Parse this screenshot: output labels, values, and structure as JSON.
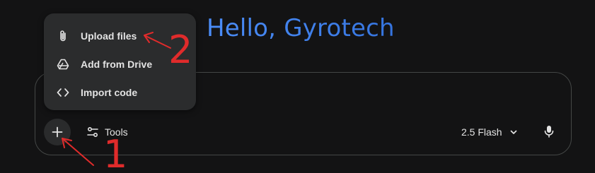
{
  "greeting": "Hello, Gyrotech",
  "composer": {
    "tools_label": "Tools",
    "model_label": "2.5 Flash"
  },
  "menu": {
    "items": [
      {
        "label": "Upload files",
        "icon": "paperclip-icon"
      },
      {
        "label": "Add from Drive",
        "icon": "drive-icon"
      },
      {
        "label": "Import code",
        "icon": "code-icon"
      }
    ]
  },
  "annotations": {
    "step1": "1",
    "step2": "2"
  },
  "colors": {
    "background": "#131314",
    "greeting": "#4285f4",
    "annotation": "#e02b2b",
    "menu_background": "#2b2c2d"
  }
}
